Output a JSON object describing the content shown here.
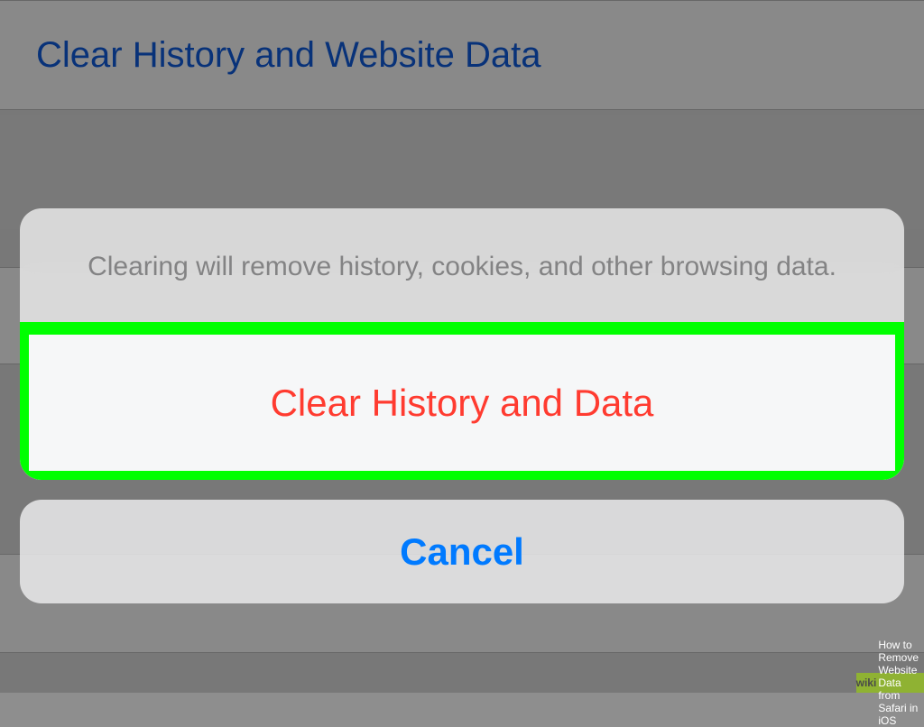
{
  "settings": {
    "title": "Clear History and Website Data"
  },
  "sheet": {
    "message": "Clearing will remove history, cookies, and other browsing data.",
    "destructive_action": "Clear History and Data",
    "cancel": "Cancel"
  },
  "watermark": {
    "prefix": "wiki",
    "text": "How to Remove Website Data from Safari in iOS"
  }
}
